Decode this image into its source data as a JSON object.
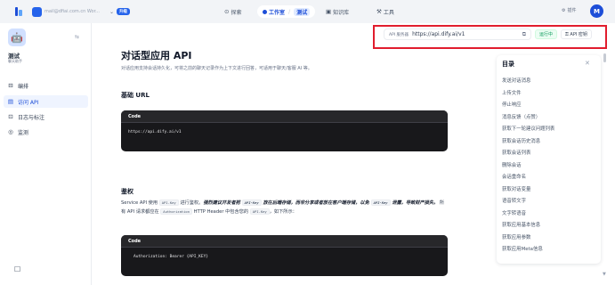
{
  "topbar": {
    "workspace_name": "mail@dfiai.com.cn Wor...",
    "workspace_chevron": "⌄",
    "upgrade_label": "升级",
    "nav": {
      "explore": "探索",
      "studio": "工作室",
      "current_app": "测试",
      "knowledge": "知识库",
      "tools": "工具"
    },
    "plugins_label": "插件",
    "user_initial": "M"
  },
  "sidebar": {
    "app_emoji": "🤖",
    "app_title": "测试",
    "app_type": "聊天助手",
    "items": [
      {
        "label": "编排",
        "icon": "⊟"
      },
      {
        "label": "访问 API",
        "icon": "▤"
      },
      {
        "label": "日志与标注",
        "icon": "⊡"
      },
      {
        "label": "监测",
        "icon": "◎"
      }
    ],
    "footer_icon": "☐"
  },
  "api_bar": {
    "label": "API 服务器",
    "url": "https://api.dify.ai/v1",
    "status": "运行中",
    "key_button": "API 密钥"
  },
  "doc": {
    "title": "对话型应用 API",
    "intro": "对话应用支持会话持久化，可将之前的聊天记录作为上下文进行回答，可适用于聊天/客服 AI 等。",
    "base_url_heading": "基础 URL",
    "base_url_code_label": "Code",
    "base_url_code": "https://api.dify.ai/v1",
    "auth_heading": "鉴权",
    "auth_p1": "Service API 使用 ",
    "auth_code_key": "API-Key",
    "auth_p2": " 进行鉴权。",
    "auth_strong1": "强烈建议开发者把 ",
    "auth_strong2": " 放在后端存储，而非分享或者放在客户端存储，以免 ",
    "auth_strong3": " 泄露，导致财产损失。",
    "auth_p3": " 所有 API 请求都应在 ",
    "auth_code_header": "Authorization",
    "auth_p4": " HTTP Header 中包含您的 ",
    "auth_p5": "，如下所示：",
    "auth_code_label": "Code",
    "auth_code": "Authorization: Bearer {API_KEY}"
  },
  "toc": {
    "title": "目录",
    "items": [
      "发送对话消息",
      "上传文件",
      "停止响应",
      "消息反馈（点赞）",
      "获取下一轮建议问题列表",
      "获取会话历史消息",
      "获取会话列表",
      "删除会话",
      "会话重命名",
      "获取对话变量",
      "语音转文字",
      "文字转语音",
      "获取应用基本信息",
      "获取应用参数",
      "获取应用Meta信息"
    ]
  }
}
